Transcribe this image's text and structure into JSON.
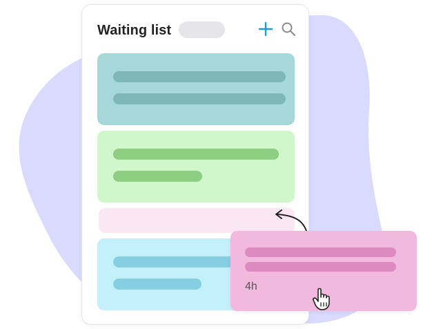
{
  "header": {
    "title": "Waiting list"
  },
  "icons": {
    "add": "plus-icon",
    "search": "search-icon",
    "cursor": "hand-pointer-icon"
  },
  "colors": {
    "blob": "#d9dafe",
    "accent": "#1a9bd7",
    "card_teal": "#a6d8d9",
    "card_green": "#cff7cb",
    "card_pink_light": "#fbe6f3",
    "card_cyan": "#c3f0fb",
    "card_pink_drag": "#f2b9de"
  },
  "dragged_card": {
    "time": "4h"
  }
}
